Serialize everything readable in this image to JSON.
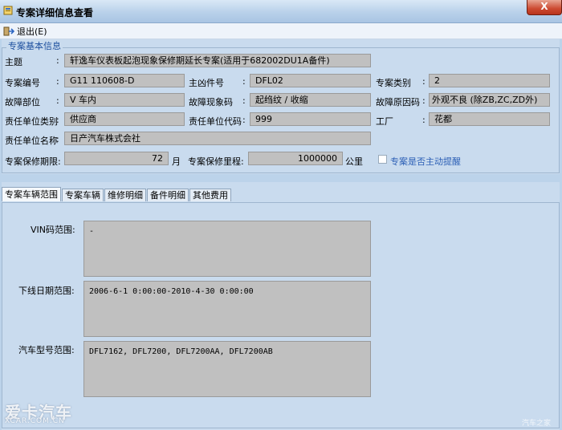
{
  "window": {
    "title": "专案详细信息查看",
    "close_glyph": "X"
  },
  "menu": {
    "exit_label": "退出(E)"
  },
  "group": {
    "legend": "专案基本信息"
  },
  "fields": {
    "topic": {
      "label": "主题",
      "value": "轩逸车仪表板起泡现象保修期延长专案(适用于682002DU1A备件)"
    },
    "case_no": {
      "label": "专案编号",
      "value": "G11 110608-D"
    },
    "main_part": {
      "label": "主凶件号",
      "value": "DFL02"
    },
    "case_type": {
      "label": "专案类别",
      "value": "2"
    },
    "fault_location": {
      "label": "故障部位",
      "value": "V 车内"
    },
    "fault_symptom": {
      "label": "故障现象码",
      "value": "起绉纹 / 收缩"
    },
    "fault_cause": {
      "label": "故障原因码",
      "value": "外观不良 (除ZB,ZC,ZD外)"
    },
    "resp_unit_type": {
      "label": "责任单位类别",
      "value": "供应商"
    },
    "resp_unit_code": {
      "label": "责任单位代码",
      "value": "999"
    },
    "factory": {
      "label": "工厂",
      "value": "花都"
    },
    "resp_unit_name": {
      "label": "责任单位名称",
      "value": "日产汽车株式会社"
    },
    "warranty_period": {
      "label": "专案保修期限:",
      "value": "72",
      "unit": "月"
    },
    "warranty_mileage": {
      "label": "专案保修里程:",
      "value": "1000000",
      "unit": "公里"
    },
    "auto_remind": {
      "label": "专案是否主动提醒",
      "checked": false
    }
  },
  "tabs": [
    {
      "label": "专案车辆范围",
      "active": true
    },
    {
      "label": "专案车辆",
      "active": false
    },
    {
      "label": "维修明细",
      "active": false
    },
    {
      "label": "备件明细",
      "active": false
    },
    {
      "label": "其他费用",
      "active": false
    }
  ],
  "vehicle_range": {
    "vin": {
      "label": "VIN码范围:",
      "value": "-"
    },
    "offline_date": {
      "label": "下线日期范围:",
      "value": "2006-6-1 0:00:00-2010-4-30 0:00:00"
    },
    "model": {
      "label": "汽车型号范围:",
      "value": "DFL7162, DFL7200, DFL7200AA, DFL7200AB"
    }
  },
  "watermark": {
    "main": "爱卡汽车",
    "sub": "XCAR.COM.CN",
    "right": "汽车之家"
  },
  "colors": {
    "field_bg": "#c0c0c0",
    "panel_bg": "#c9dbee",
    "legend": "#1d4f9e",
    "close": "#cc4a31"
  }
}
